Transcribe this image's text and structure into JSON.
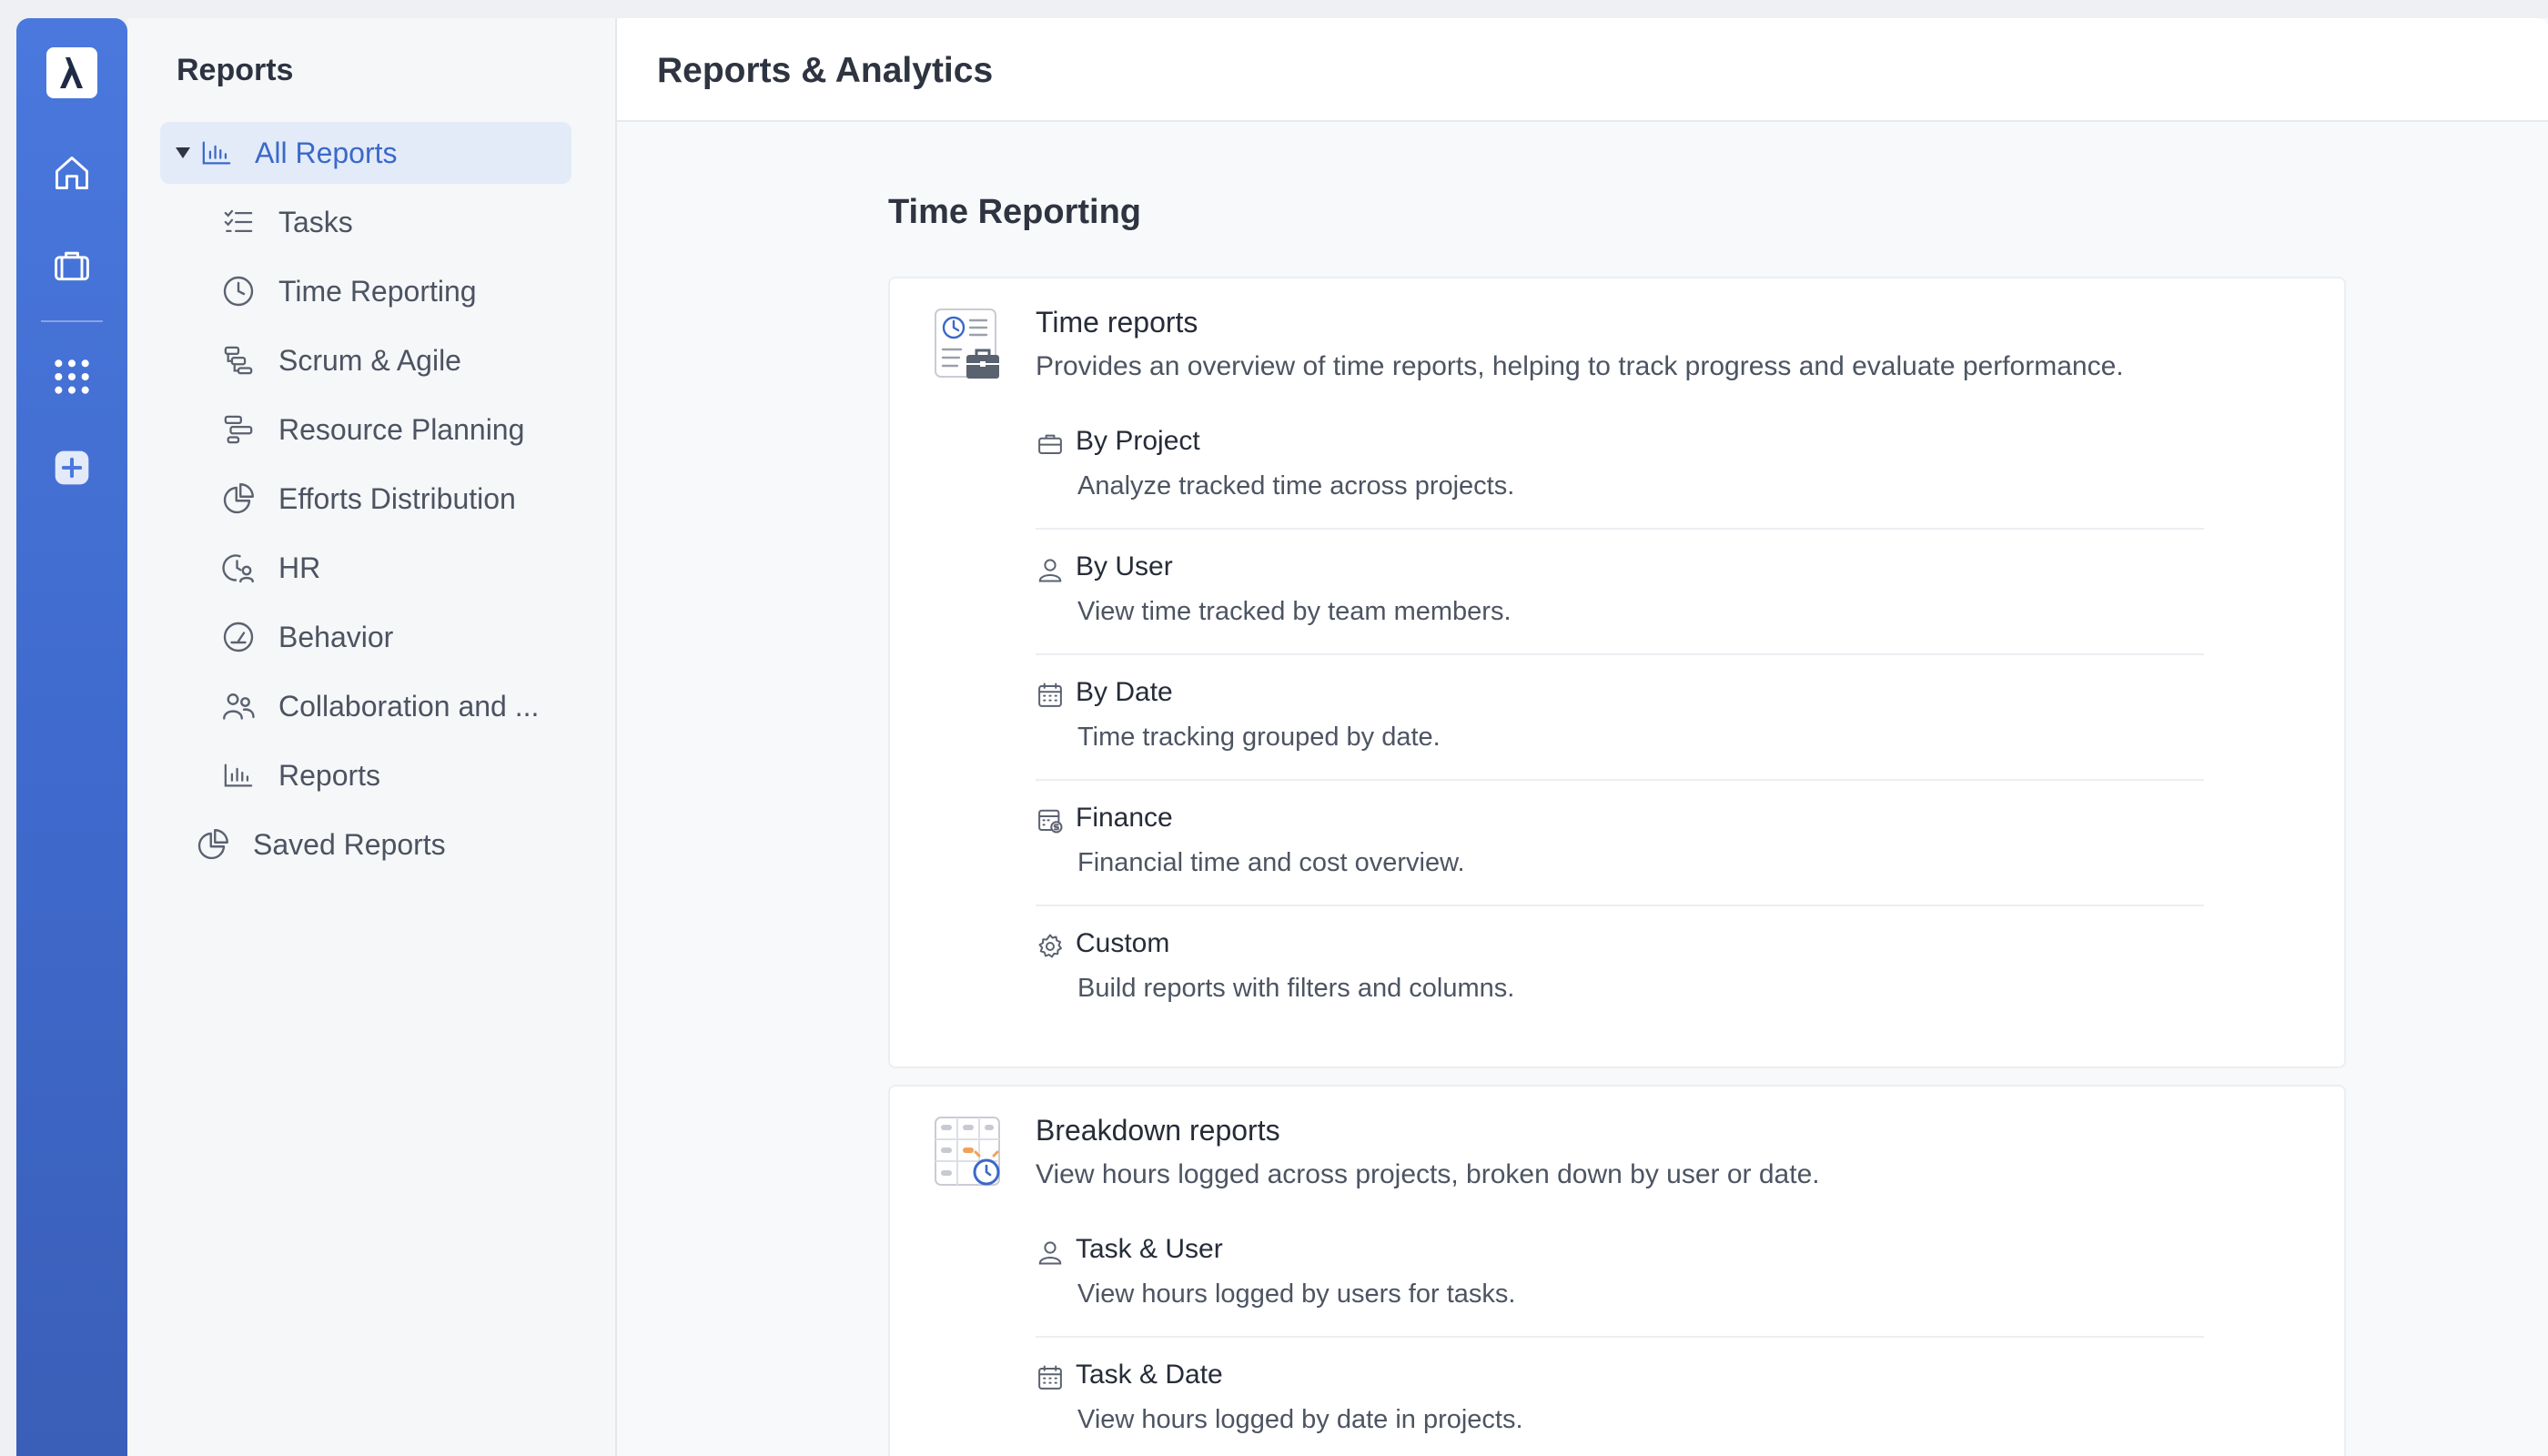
{
  "sidebar": {
    "title": "Reports",
    "items": [
      {
        "label": "All Reports"
      },
      {
        "label": "Tasks"
      },
      {
        "label": "Time Reporting"
      },
      {
        "label": "Scrum & Agile"
      },
      {
        "label": "Resource Planning"
      },
      {
        "label": "Efforts Distribution"
      },
      {
        "label": "HR"
      },
      {
        "label": "Behavior"
      },
      {
        "label": "Collaboration and ..."
      },
      {
        "label": "Reports"
      },
      {
        "label": "Saved Reports"
      }
    ]
  },
  "header": {
    "title": "Reports & Analytics"
  },
  "section": {
    "title": "Time Reporting"
  },
  "cards": [
    {
      "title": "Time reports",
      "description": "Provides an overview of time reports, helping to track progress and evaluate performance.",
      "rows": [
        {
          "title": "By Project",
          "description": "Analyze tracked time across projects."
        },
        {
          "title": "By User",
          "description": "View time tracked by team members."
        },
        {
          "title": "By Date",
          "description": "Time tracking grouped by date."
        },
        {
          "title": "Finance",
          "description": "Financial time and cost overview."
        },
        {
          "title": "Custom",
          "description": "Build reports with filters and columns."
        }
      ]
    },
    {
      "title": "Breakdown reports",
      "description": "View hours logged across projects, broken down by user or date.",
      "rows": [
        {
          "title": "Task & User",
          "description": "View hours logged by users for tasks."
        },
        {
          "title": "Task & Date",
          "description": "View hours logged by date in projects."
        }
      ]
    }
  ],
  "colors": {
    "rail": "#4a78dd",
    "accent": "#3b69c9",
    "active_bg": "#e3ebf9"
  }
}
